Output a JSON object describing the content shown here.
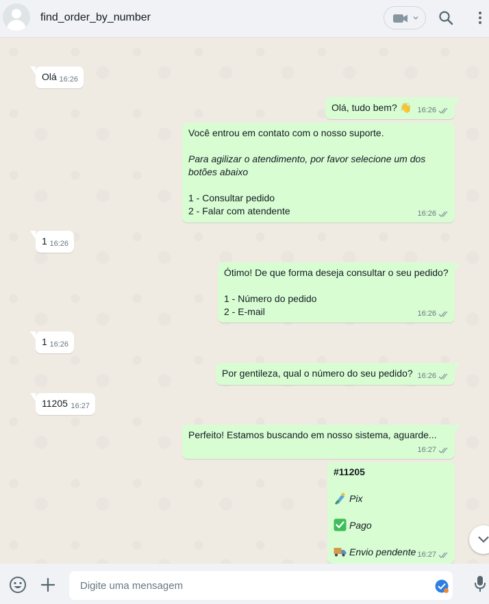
{
  "header": {
    "title": "find_order_by_number"
  },
  "messages": [
    {
      "dir": "in",
      "lines": [
        "Olá"
      ],
      "time": "16:26"
    },
    {
      "dir": "out",
      "lines": [
        "Olá, tudo bem? 👋"
      ],
      "time": "16:26",
      "emoji": "waving-hand"
    },
    {
      "dir": "out",
      "lines": [
        "Você entrou em contato com o nosso suporte.",
        "",
        "Para agilizar o atendimento, por favor selecione um dos",
        "botões abaixo",
        "",
        "1 - Consultar pedido",
        "2 - Falar com atendente"
      ],
      "time": "16:26"
    },
    {
      "dir": "in",
      "lines": [
        "1"
      ],
      "time": "16:26"
    },
    {
      "dir": "out",
      "lines": [
        "Ótimo! De que forma deseja consultar o seu pedido?",
        "",
        "1 - Número do pedido",
        "2 - E-mail"
      ],
      "time": "16:26"
    },
    {
      "dir": "in",
      "lines": [
        "1"
      ],
      "time": "16:26"
    },
    {
      "dir": "out",
      "lines": [
        "Por gentileza, qual o número do seu pedido?"
      ],
      "time": "16:26"
    },
    {
      "dir": "in",
      "lines": [
        "11205"
      ],
      "time": "16:27"
    },
    {
      "dir": "out",
      "lines": [
        "Perfeito! Estamos buscando em nosso sistema, aguarde..."
      ],
      "time": "16:27"
    },
    {
      "dir": "out",
      "order_number": "#11205",
      "payment_method": "Pix",
      "payment_status": "Pago",
      "shipping_status": "Envio pendente",
      "time": "16:27"
    }
  ],
  "composer": {
    "placeholder": "Digite uma mensagem"
  },
  "colors": {
    "incoming_bubble": "#ffffff",
    "outgoing_bubble": "#d9fdd3",
    "chat_background": "#efeae2",
    "panel": "#f0f2f5",
    "check_green": "#3ebd5a"
  }
}
